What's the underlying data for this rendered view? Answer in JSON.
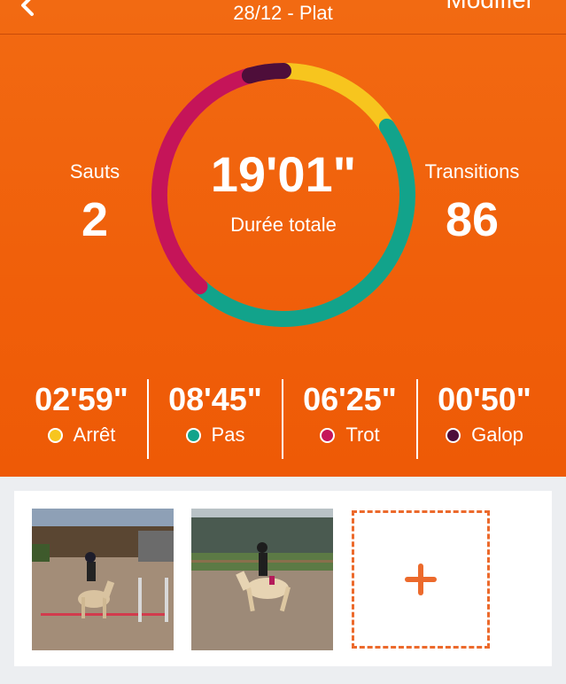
{
  "header": {
    "subtitle": "28/12 - Plat",
    "edit_label": "Modifier"
  },
  "summary": {
    "jumps_label": "Sauts",
    "jumps_value": "2",
    "total_time": "19'01\"",
    "total_label": "Durée totale",
    "transitions_label": "Transitions",
    "transitions_value": "86"
  },
  "gaits": [
    {
      "time": "02'59\"",
      "label": "Arrêt",
      "color": "#f7c51e"
    },
    {
      "time": "08'45\"",
      "label": "Pas",
      "color": "#12a38b"
    },
    {
      "time": "06'25\"",
      "label": "Trot",
      "color": "#c51459"
    },
    {
      "time": "00'50\"",
      "label": "Galop",
      "color": "#4e0e3a"
    }
  ],
  "colors": {
    "hero_orange": "#f0600a",
    "add_border": "#ec6a2c"
  },
  "icons": {
    "back": "chevron-left-icon",
    "add": "plus-icon"
  }
}
